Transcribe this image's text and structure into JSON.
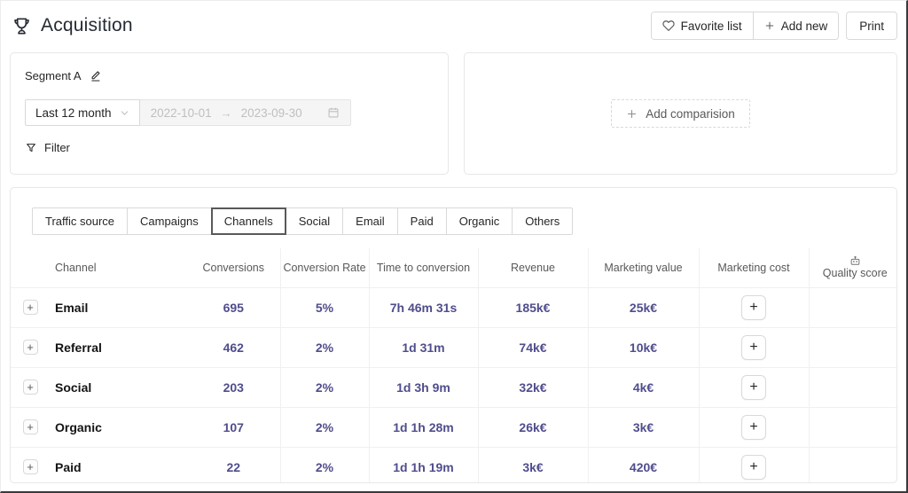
{
  "header": {
    "title": "Acquisition",
    "favorite_label": "Favorite list",
    "add_new_label": "Add new",
    "print_label": "Print"
  },
  "segment": {
    "name": "Segment A",
    "preset": "Last 12 month",
    "date_start": "2022-10-01",
    "date_end": "2023-09-30",
    "date_arrow": "→",
    "filter_label": "Filter"
  },
  "comparison": {
    "add_label": "Add comparision"
  },
  "tabs": [
    "Traffic source",
    "Campaigns",
    "Channels",
    "Social",
    "Email",
    "Paid",
    "Organic",
    "Others"
  ],
  "active_tab": "Channels",
  "table": {
    "columns": [
      "Channel",
      "Conversions",
      "Conversion Rate",
      "Time to conversion",
      "Revenue",
      "Marketing value",
      "Marketing cost",
      "Quality score"
    ],
    "expand_glyph": "+",
    "add_cost_glyph": "+",
    "rows": [
      {
        "channel": "Email",
        "conversions": "695",
        "conversion_rate": "5%",
        "time_to_conversion": "7h 46m 31s",
        "revenue": "185k€",
        "marketing_value": "25k€"
      },
      {
        "channel": "Referral",
        "conversions": "462",
        "conversion_rate": "2%",
        "time_to_conversion": "1d 31m",
        "revenue": "74k€",
        "marketing_value": "10k€"
      },
      {
        "channel": "Social",
        "conversions": "203",
        "conversion_rate": "2%",
        "time_to_conversion": "1d 3h 9m",
        "revenue": "32k€",
        "marketing_value": "4k€"
      },
      {
        "channel": "Organic",
        "conversions": "107",
        "conversion_rate": "2%",
        "time_to_conversion": "1d 1h 28m",
        "revenue": "26k€",
        "marketing_value": "3k€"
      },
      {
        "channel": "Paid",
        "conversions": "22",
        "conversion_rate": "2%",
        "time_to_conversion": "1d 1h 19m",
        "revenue": "3k€",
        "marketing_value": "420€"
      }
    ]
  },
  "icons": {
    "trophy": "trophy-outline",
    "heart": "heart-outline",
    "plus": "+",
    "edit": "pencil-underline",
    "chevron_down": "∨",
    "calendar": "calendar-outline",
    "filter": "funnel-outline",
    "robot": "robot-head"
  },
  "colors": {
    "metric_text": "#4f4d8c",
    "active_tab_border": "#595959"
  }
}
